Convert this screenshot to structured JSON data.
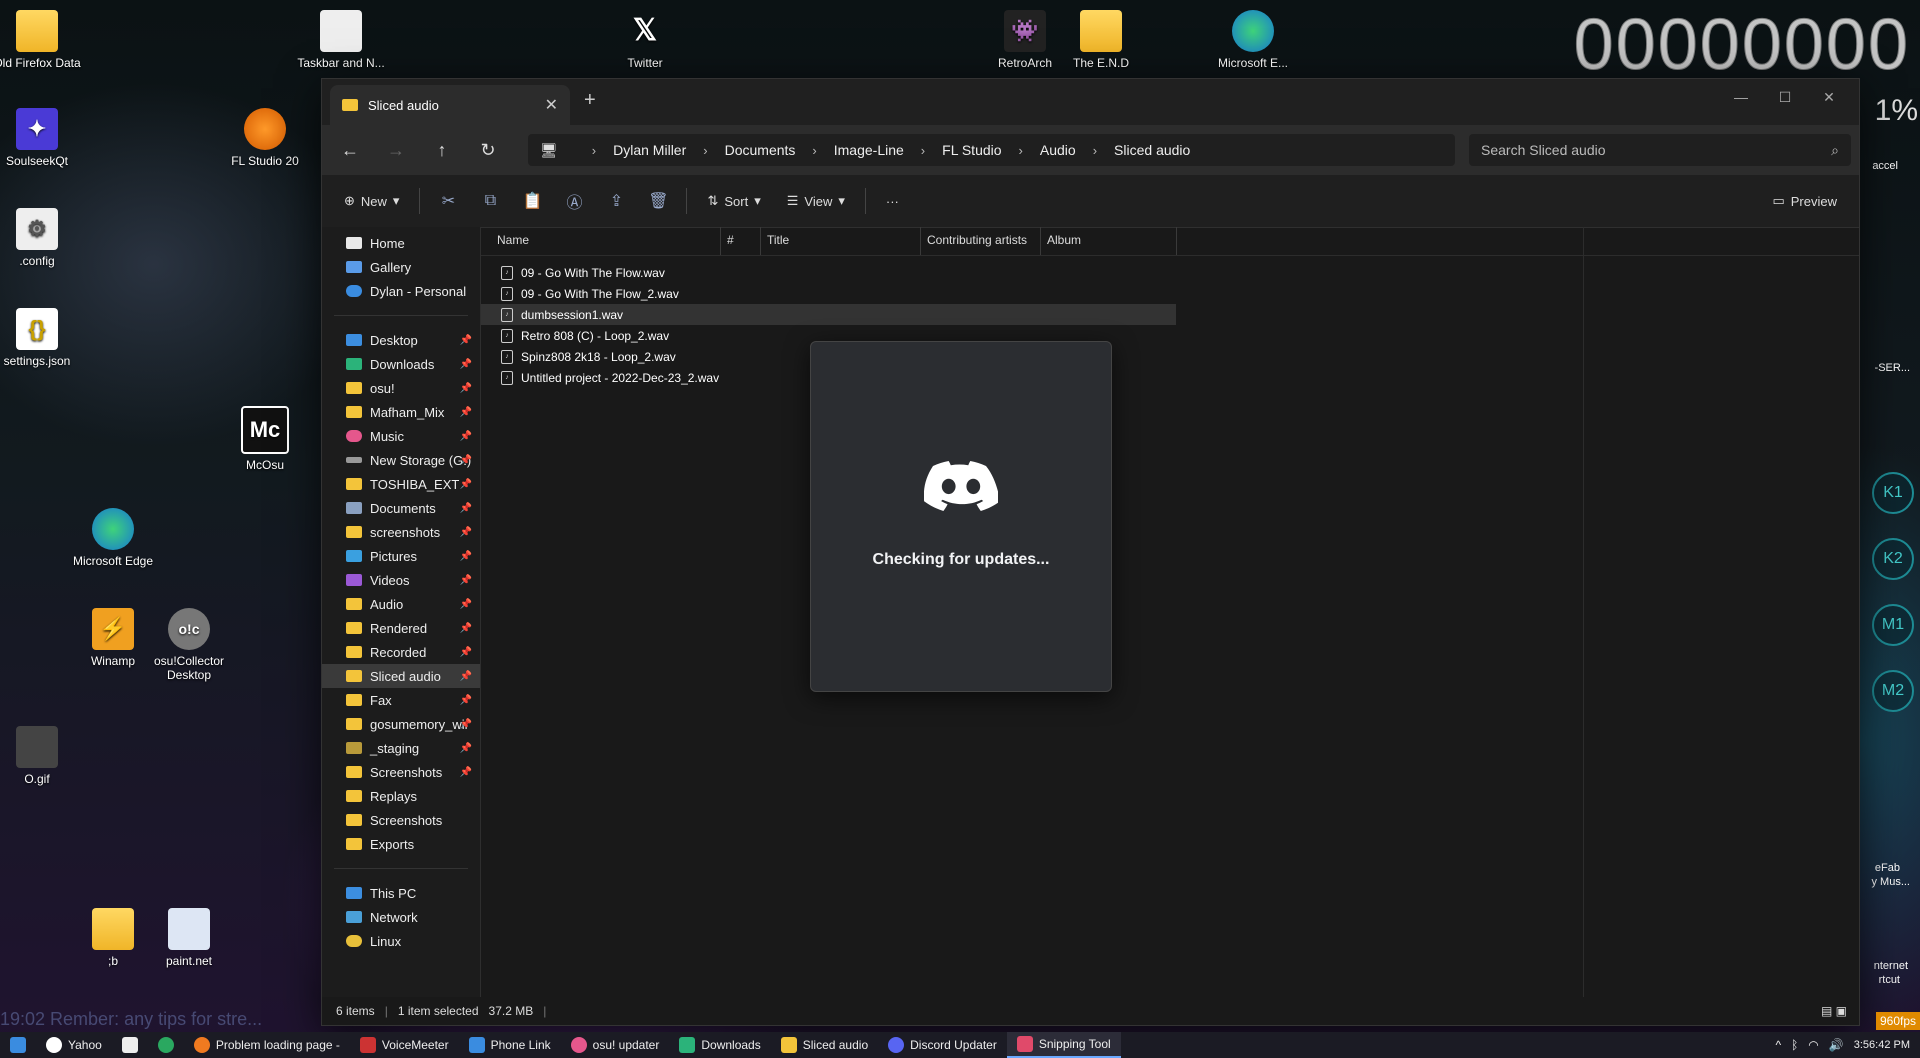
{
  "desktop": {
    "icons": [
      {
        "label": "Old Firefox Data"
      },
      {
        "label": "SoulseekQt"
      },
      {
        "label": ".config"
      },
      {
        "label": "settings.json"
      },
      {
        "label": "Microsoft Edge"
      },
      {
        "label": "Winamp"
      },
      {
        "label": "O.gif"
      },
      {
        "label": "Taskbar and N..."
      },
      {
        "label": "FL Studio 20"
      },
      {
        "label": "McOsu"
      },
      {
        "label": "osu!Collector Desktop"
      },
      {
        "label": ";b"
      },
      {
        "label": "paint.net"
      },
      {
        "label": "Twitter"
      },
      {
        "label": "RetroArch"
      },
      {
        "label": "The E.N.D"
      },
      {
        "label": "Microsoft E..."
      }
    ],
    "counter": "00000000",
    "right_text": {
      "pct": "1%",
      "accel": "accel",
      "ser": "-SER...",
      "efab": "eFab",
      "ymus": "y Mus...",
      "internet": "nternet",
      "shortcut": "rtcut"
    },
    "keys": [
      "K1",
      "K2",
      "M1",
      "M2"
    ],
    "marquee": "19:02 Rember: any tips for stre...",
    "fps": "960fps"
  },
  "explorer": {
    "tab_title": "Sliced audio",
    "new_tab": "+",
    "breadcrumbs": [
      "Dylan Miller",
      "Documents",
      "Image-Line",
      "FL Studio",
      "Audio",
      "Sliced audio"
    ],
    "search_placeholder": "Search Sliced audio",
    "toolbar": {
      "new": "New",
      "sort": "Sort",
      "view": "View",
      "more": "···",
      "preview": "Preview"
    },
    "nav": {
      "top": [
        {
          "label": "Home"
        },
        {
          "label": "Gallery"
        },
        {
          "label": "Dylan - Personal"
        }
      ],
      "quick": [
        {
          "label": "Desktop"
        },
        {
          "label": "Downloads"
        },
        {
          "label": "osu!"
        },
        {
          "label": "Mafham_Mix"
        },
        {
          "label": "Music"
        },
        {
          "label": "New Storage (G:)"
        },
        {
          "label": "TOSHIBA_EXT"
        },
        {
          "label": "Documents"
        },
        {
          "label": "screenshots"
        },
        {
          "label": "Pictures"
        },
        {
          "label": "Videos"
        },
        {
          "label": "Audio"
        },
        {
          "label": "Rendered"
        },
        {
          "label": "Recorded"
        },
        {
          "label": "Sliced audio"
        },
        {
          "label": "Fax"
        },
        {
          "label": "gosumemory_wir"
        },
        {
          "label": "_staging"
        },
        {
          "label": "Screenshots"
        },
        {
          "label": "Replays"
        },
        {
          "label": "Screenshots"
        },
        {
          "label": "Exports"
        }
      ],
      "bottom": [
        {
          "label": "This PC"
        },
        {
          "label": "Network"
        },
        {
          "label": "Linux"
        }
      ]
    },
    "columns": [
      "Name",
      "#",
      "Title",
      "Contributing artists",
      "Album"
    ],
    "files": [
      {
        "name": "09 - Go With The Flow.wav"
      },
      {
        "name": "09 - Go With The Flow_2.wav"
      },
      {
        "name": "dumbsession1.wav"
      },
      {
        "name": "Retro 808 (C) - Loop_2.wav"
      },
      {
        "name": "Spinz808 2k18 - Loop_2.wav"
      },
      {
        "name": "Untitled project - 2022-Dec-23_2.wav"
      }
    ],
    "selected_index": 2,
    "status": {
      "count": "6 items",
      "selected": "1 item selected",
      "size": "37.2 MB"
    }
  },
  "discord": {
    "message": "Checking for updates..."
  },
  "taskbar": {
    "items": [
      {
        "label": "Yahoo"
      },
      {
        "label": ""
      },
      {
        "label": ""
      },
      {
        "label": "Problem loading page -"
      },
      {
        "label": "VoiceMeeter"
      },
      {
        "label": "Phone Link"
      },
      {
        "label": "osu! updater"
      },
      {
        "label": "Downloads"
      },
      {
        "label": "Sliced audio"
      },
      {
        "label": "Discord Updater"
      },
      {
        "label": "Snipping Tool"
      }
    ],
    "time": "3:56:42 PM"
  }
}
